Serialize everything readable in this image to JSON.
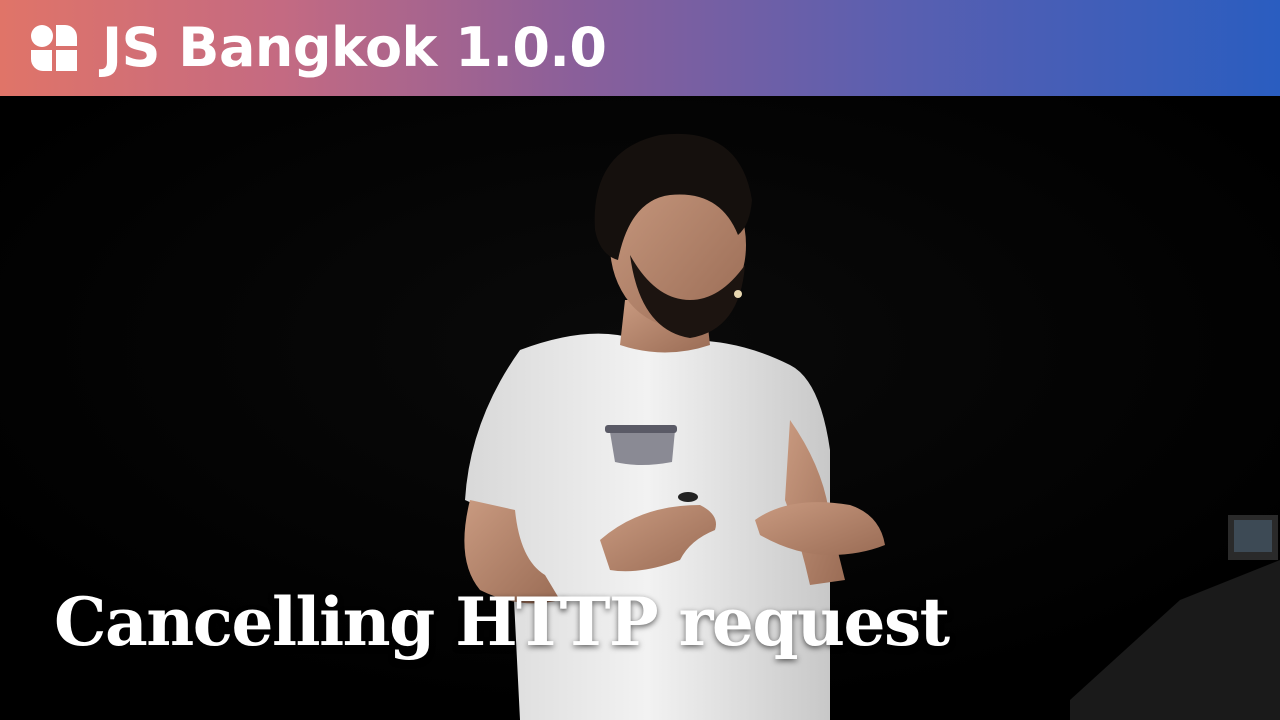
{
  "banner": {
    "title": "JS Bangkok 1.0.0",
    "icon": "jsbangkok-logo-icon",
    "gradient": [
      "#e07468",
      "#8a5f9a",
      "#2a5dc0"
    ]
  },
  "caption": {
    "text": "Cancelling HTTP request"
  },
  "scene": {
    "subject": "speaker-icon",
    "background": "#000000",
    "shirt_color": "#f0f0f0"
  }
}
